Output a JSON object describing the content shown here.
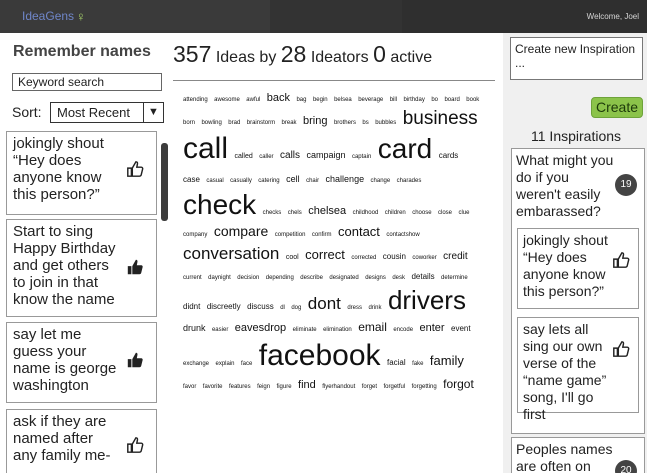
{
  "header": {
    "logo": "IdeaGens",
    "logo_icon": "lightbulb-icon",
    "welcome": "Welcome, Joel"
  },
  "left": {
    "title": "Remember names",
    "keyword_placeholder": "Keyword search",
    "sort_label": "Sort:",
    "sort_value": "Most Recent",
    "ideas": [
      {
        "text": "jokingly shout “Hey does anyone know this person?”",
        "liked": false
      },
      {
        "text": "Start to sing Happy Birthday and get others to join in that know the name",
        "liked": true
      },
      {
        "text": "say let me guess your name is george washington",
        "liked": true
      },
      {
        "text": "ask if they are named after any family me-",
        "liked": false
      }
    ]
  },
  "center": {
    "ideas_count": "357",
    "ideas_label": "Ideas by",
    "ideators_count": "28",
    "ideators_label": "Ideators",
    "active_count": "0",
    "active_label": "active",
    "cloud_rows": [
      [
        [
          "attending",
          6
        ],
        [
          "awesome",
          6
        ],
        [
          "awful",
          6
        ],
        [
          "back",
          11
        ],
        [
          "bag",
          6
        ],
        [
          "begin",
          6
        ],
        [
          "belsea",
          6
        ],
        [
          "beverage",
          6
        ],
        [
          "bill",
          6
        ],
        [
          "birthday",
          6
        ],
        [
          "bo",
          6
        ],
        [
          "board",
          6
        ],
        [
          "book",
          6
        ]
      ],
      [
        [
          "born",
          6
        ],
        [
          "bowling",
          6
        ],
        [
          "brad",
          6
        ],
        [
          "brainstorm",
          6
        ],
        [
          "break",
          6
        ],
        [
          "bring",
          11
        ],
        [
          "brothers",
          6
        ],
        [
          "bs",
          6
        ],
        [
          "bubbles",
          6
        ],
        [
          "business",
          19
        ]
      ],
      [
        [
          "call",
          30
        ],
        [
          "called",
          7
        ],
        [
          "caller",
          6
        ],
        [
          "calls",
          10
        ],
        [
          "campaign",
          9
        ],
        [
          "captain",
          6
        ],
        [
          "card",
          28
        ],
        [
          "cards",
          8
        ]
      ],
      [
        [
          "case",
          8
        ],
        [
          "casual",
          6
        ],
        [
          "casually",
          6
        ],
        [
          "catering",
          6
        ],
        [
          "cell",
          9
        ],
        [
          "chair",
          6
        ],
        [
          "challenge",
          9
        ],
        [
          "change",
          6
        ],
        [
          "charades",
          6
        ]
      ],
      [
        [
          "check",
          28
        ],
        [
          "checks",
          6
        ],
        [
          "chels",
          6
        ],
        [
          "chelsea",
          11
        ],
        [
          "childhood",
          6
        ],
        [
          "children",
          6
        ],
        [
          "choose",
          6
        ],
        [
          "close",
          6
        ],
        [
          "clue",
          6
        ]
      ],
      [
        [
          "company",
          6
        ],
        [
          "compare",
          14
        ],
        [
          "competition",
          6
        ],
        [
          "confirm",
          6
        ],
        [
          "contact",
          13
        ],
        [
          "contactshow",
          6
        ]
      ],
      [
        [
          "conversation",
          17
        ],
        [
          "cool",
          7
        ],
        [
          "correct",
          13
        ],
        [
          "corrected",
          6
        ],
        [
          "cousin",
          8
        ],
        [
          "coworker",
          6
        ],
        [
          "credit",
          10
        ]
      ],
      [
        [
          "current",
          6
        ],
        [
          "daynight",
          6
        ],
        [
          "decision",
          6
        ],
        [
          "depending",
          6
        ],
        [
          "describe",
          6
        ],
        [
          "designated",
          6
        ],
        [
          "designs",
          6
        ],
        [
          "desk",
          6
        ],
        [
          "details",
          8
        ],
        [
          "determine",
          6
        ]
      ],
      [
        [
          "didnt",
          8
        ],
        [
          "discreetly",
          8
        ],
        [
          "discuss",
          8
        ],
        [
          "dl",
          6
        ],
        [
          "dog",
          6
        ],
        [
          "dont",
          17
        ],
        [
          "dress",
          6
        ],
        [
          "drink",
          6
        ],
        [
          "drivers",
          26
        ]
      ],
      [
        [
          "drunk",
          9
        ],
        [
          "easier",
          6
        ],
        [
          "eavesdrop",
          11
        ],
        [
          "eliminate",
          6
        ],
        [
          "elimination",
          6
        ],
        [
          "email",
          12
        ],
        [
          "encode",
          6
        ],
        [
          "enter",
          11
        ],
        [
          "event",
          8
        ]
      ],
      [
        [
          "exchange",
          6
        ],
        [
          "explain",
          6
        ],
        [
          "face",
          6
        ],
        [
          "facebook",
          30
        ],
        [
          "facial",
          8
        ],
        [
          "fake",
          6
        ],
        [
          "family",
          13
        ]
      ],
      [
        [
          "favor",
          6
        ],
        [
          "favorite",
          6
        ],
        [
          "features",
          6
        ],
        [
          "feign",
          6
        ],
        [
          "figure",
          6
        ],
        [
          "find",
          11
        ],
        [
          "flyerhandout",
          6
        ],
        [
          "forget",
          6
        ],
        [
          "forgetful",
          6
        ],
        [
          "forgetting",
          6
        ],
        [
          "forgot",
          12
        ]
      ]
    ]
  },
  "right": {
    "create_placeholder": "Create new Inspiration ...",
    "create_button": "Create",
    "inspirations_count": "11 Inspirations",
    "inspirations": [
      {
        "text": "What might you do if you weren't easily embarassed?",
        "count": "19",
        "ideas": [
          {
            "text": "jokingly shout “Hey does anyone know this person?”",
            "liked": false
          },
          {
            "text": "say lets all sing our own verse of the “name game” song, I'll go first",
            "liked": false
          }
        ]
      },
      {
        "text": "Peoples names are often on",
        "count": "20"
      }
    ]
  },
  "colors": {
    "topbar": "#3a3a3a",
    "logo": "#6f86c9",
    "create_button": "#8bc34a",
    "badge": "#444444"
  }
}
